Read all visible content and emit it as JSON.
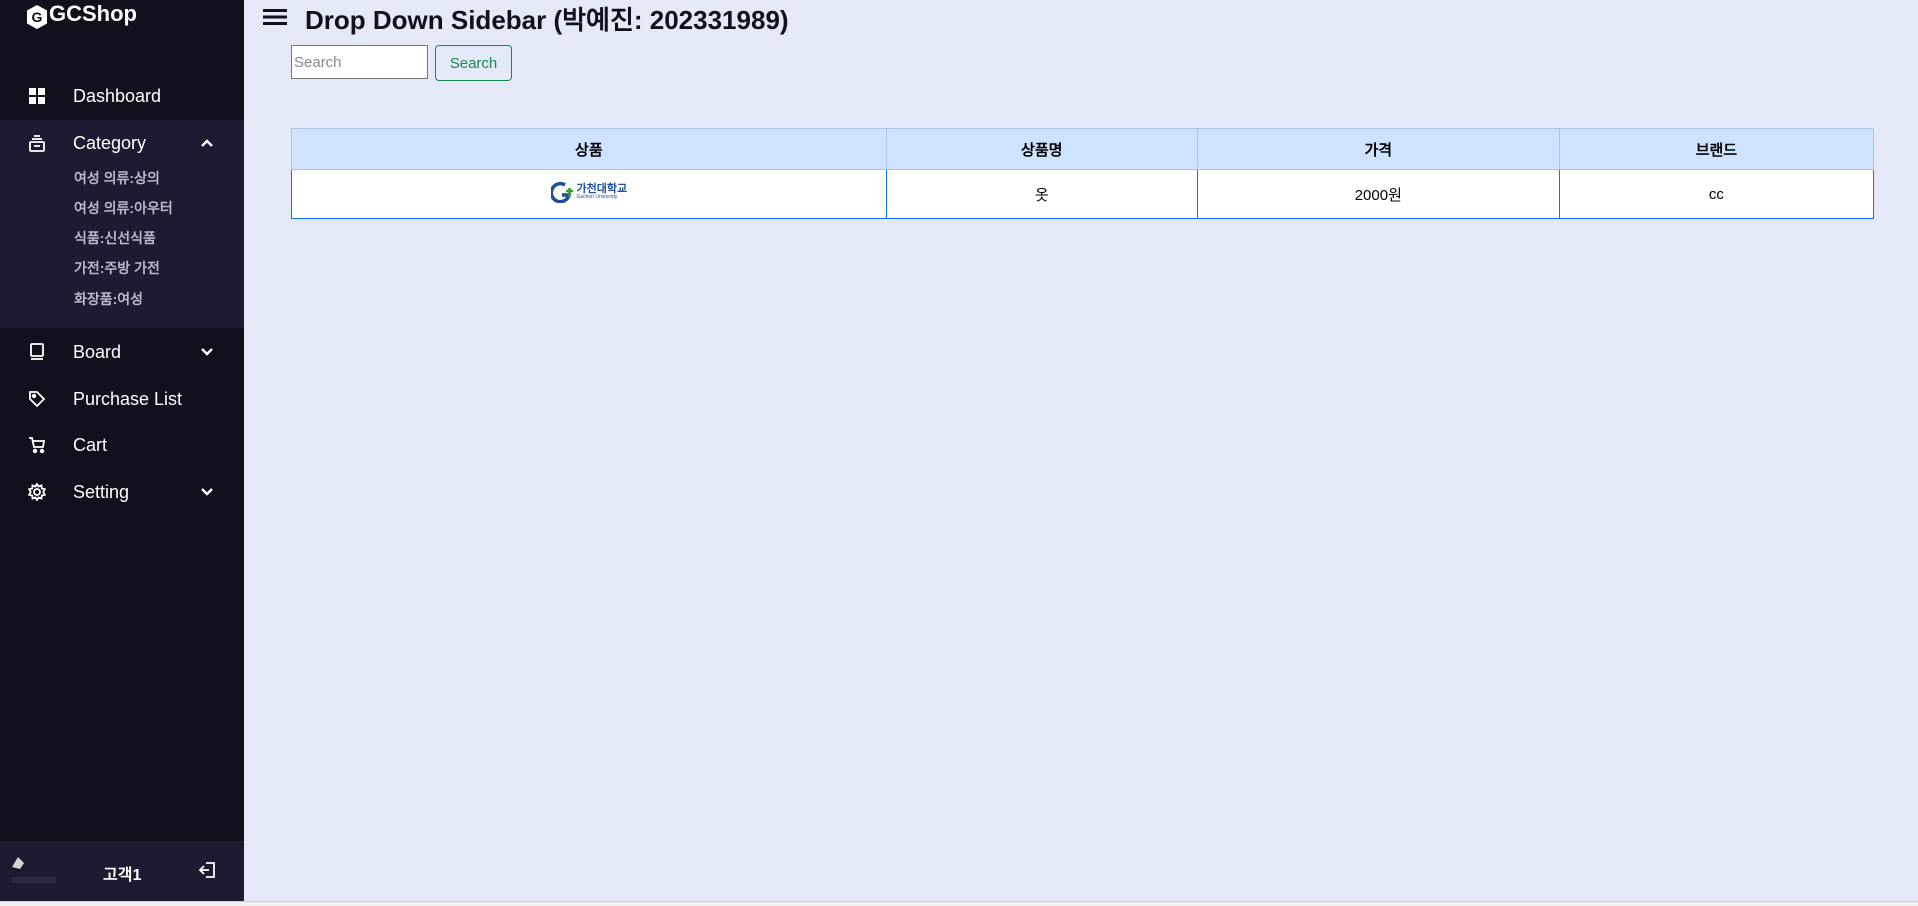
{
  "sidebar": {
    "logo_text": "GCShop",
    "items": [
      {
        "label": "Dashboard",
        "icon": "grid-icon"
      },
      {
        "label": "Category",
        "icon": "layers-icon"
      },
      {
        "label": "Board",
        "icon": "book-icon"
      },
      {
        "label": "Purchase List",
        "icon": "tag-icon"
      },
      {
        "label": "Cart",
        "icon": "cart-icon"
      },
      {
        "label": "Setting",
        "icon": "gear-icon"
      }
    ],
    "category_submenu": [
      "여성 의류:상의",
      "여성 의류:아우터",
      "식품:신선식품",
      "가전:주방 가전",
      "화장품:여성"
    ],
    "profile": {
      "name": "고객1"
    }
  },
  "header": {
    "title": "Drop Down Sidebar (박예진: 202331989)"
  },
  "search": {
    "placeholder": "Search",
    "button_label": "Search"
  },
  "table": {
    "headers": [
      "상품",
      "상품명",
      "가격",
      "브랜드"
    ],
    "rows": [
      {
        "image_logo": "가천대학교",
        "image_logo_sub": "Gachon University",
        "name": "옷",
        "price": "2000원",
        "brand": "cc"
      }
    ]
  },
  "colors": {
    "sidebar_bg": "#11101d",
    "submenu_bg": "#1d1b31",
    "main_bg": "#e4e9f7",
    "table_header_bg": "#cfe2ff",
    "table_border": "#0d6efd",
    "search_button": "#198754"
  }
}
